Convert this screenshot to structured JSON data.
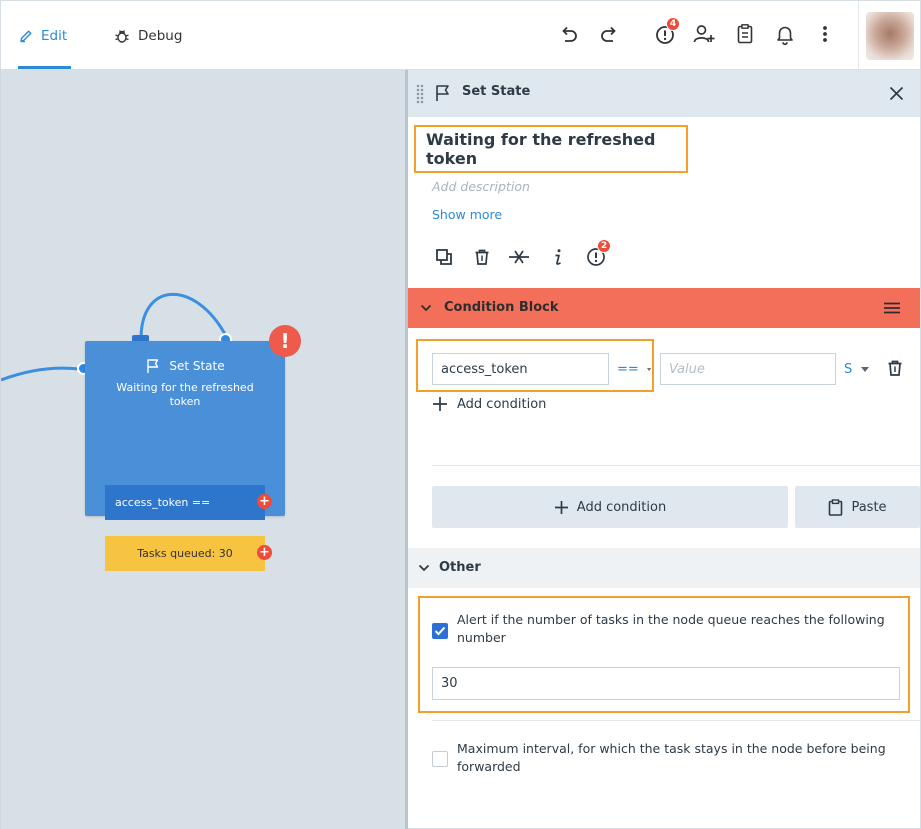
{
  "header": {
    "tabs": [
      {
        "label": "Edit",
        "active": true
      },
      {
        "label": "Debug",
        "active": false
      }
    ],
    "icons": [
      "undo-icon",
      "redo-icon",
      "alert-icon",
      "add-user-icon",
      "clipboard-icon",
      "bell-icon",
      "more-vertical-icon"
    ],
    "alert_badge": "4"
  },
  "canvas": {
    "node": {
      "type_label": "Set State",
      "name": "Waiting for the refreshed token",
      "condition": "access_token ==",
      "queue_status": "Tasks queued: 30",
      "warning": "!"
    }
  },
  "panel": {
    "title": "Set State",
    "node_name": "Waiting for the refreshed token",
    "description_placeholder": "Add description",
    "show_more": "Show more",
    "tool_badge": "2",
    "condition_block": {
      "title": "Condition Block",
      "field": "access_token",
      "operator": "==",
      "value_placeholder": "Value",
      "type_selector": "S",
      "add_condition_link": "Add condition",
      "add_condition_button": "Add condition",
      "paste_button": "Paste"
    },
    "other": {
      "title": "Other",
      "alert_option": {
        "label": "Alert if the number of tasks in the node queue reaches the following number",
        "checked": true,
        "value": "30"
      },
      "max_interval_option": {
        "label": "Maximum interval, for which the task stays in the node before being forwarded",
        "checked": false
      }
    }
  },
  "colors": {
    "accent": "#2c8ad6",
    "node_blue": "#4a90d9",
    "condition_header": "#f36f5a",
    "highlight": "#f2a028",
    "queue_yellow": "#f7c442",
    "badge_red": "#ee4b3a"
  }
}
